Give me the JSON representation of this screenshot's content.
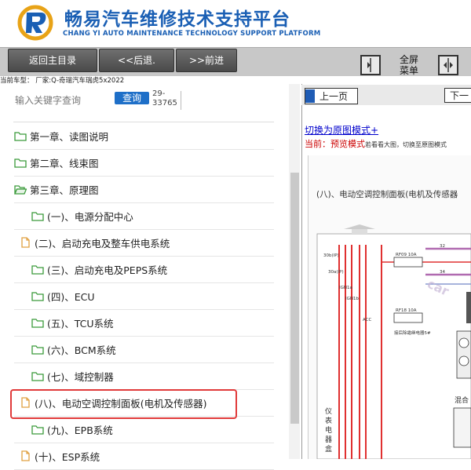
{
  "header": {
    "title": "畅易汽车维修技术支持平台",
    "subtitle": "CHANG YI AUTO MAINTENANCE TECHNOLOGY SUPPORT PLATFORM"
  },
  "toolbar": {
    "home_label": "返回主目录",
    "back_label": "<<后退.",
    "forward_label": ">>前进",
    "fullscreen_label": "全屏菜单",
    "car_model": "当前车型：  厂家:Q-奇瑞汽车瑞虎5x2022"
  },
  "search": {
    "hint": "输入关键字查询",
    "button_label": "查询",
    "count": "29-33765"
  },
  "tree": {
    "items": [
      {
        "label": "第一章、读图说明",
        "icon": "folder-icon"
      },
      {
        "label": "第二章、线束图",
        "icon": "folder-icon"
      },
      {
        "label": "第三章、原理图",
        "icon": "folder-open-icon"
      },
      {
        "label": "(一)、电源分配中心",
        "icon": "folder-icon"
      },
      {
        "label": "(二)、启动充电及整车供电系统",
        "icon": "document-icon"
      },
      {
        "label": "(三)、启动充电及PEPS系统",
        "icon": "folder-icon"
      },
      {
        "label": "(四)、ECU",
        "icon": "folder-icon"
      },
      {
        "label": "(五)、TCU系统",
        "icon": "folder-icon"
      },
      {
        "label": "(六)、BCM系统",
        "icon": "folder-icon"
      },
      {
        "label": "(七)、域控制器",
        "icon": "folder-icon"
      },
      {
        "label": "(八)、电动空调控制面板(电机及传感器)",
        "icon": "document-icon"
      },
      {
        "label": "(九)、EPB系统",
        "icon": "folder-icon"
      },
      {
        "label": "(十)、ESP系统",
        "icon": "document-icon"
      }
    ]
  },
  "viewer": {
    "prev_label": "上一页",
    "next_label": "下一",
    "switch_link": "切换为原图模式+",
    "current_label": "当前：",
    "current_mode": "预览模式",
    "current_tip": "若看看大图，切换至原图模式",
    "diagram_title": "(八)、电动空调控制面板(电机及传感器",
    "diagram": {
      "labels": [
        "30b(IP)",
        "30a(IP)",
        "IGN1a",
        "IGN1b",
        "ACC",
        "RF09 10A",
        "RF18 10A",
        "32",
        "34",
        "接后除霜继电器5#"
      ],
      "vertical_label": "仪表电器盒",
      "side_label": "混合",
      "watermark": "car"
    }
  },
  "colors": {
    "brand": "#1a5fb4",
    "highlight": "#e03a3a",
    "wire_red": "#e03030",
    "wire_purple": "#b06ab0"
  }
}
